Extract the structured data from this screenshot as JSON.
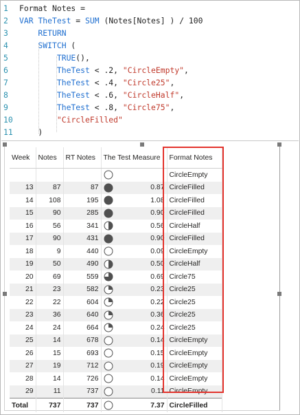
{
  "editor": {
    "lines": [
      {
        "n": "1",
        "tokens": [
          {
            "t": "Format Notes =",
            "c": "blk"
          }
        ]
      },
      {
        "n": "2",
        "tokens": [
          {
            "t": "VAR ",
            "c": "kw"
          },
          {
            "t": "TheTest",
            "c": "kw"
          },
          {
            "t": " = ",
            "c": "blk"
          },
          {
            "t": "SUM",
            "c": "kw"
          },
          {
            "t": " (Notes[Notes] ) / 100",
            "c": "blk"
          }
        ]
      },
      {
        "n": "3",
        "tokens": [
          {
            "t": "    RETURN",
            "c": "kw"
          }
        ]
      },
      {
        "n": "4",
        "tokens": [
          {
            "t": "    SWITCH",
            "c": "kw"
          },
          {
            "t": " (",
            "c": "blk"
          }
        ]
      },
      {
        "n": "5",
        "tokens": [
          {
            "t": "        TRUE",
            "c": "kw"
          },
          {
            "t": "(),",
            "c": "blk"
          }
        ]
      },
      {
        "n": "6",
        "tokens": [
          {
            "t": "        TheTest",
            "c": "kw"
          },
          {
            "t": " < .2, ",
            "c": "blk"
          },
          {
            "t": "\"CircleEmpty\"",
            "c": "str"
          },
          {
            "t": ",",
            "c": "blk"
          }
        ]
      },
      {
        "n": "7",
        "tokens": [
          {
            "t": "        TheTest",
            "c": "kw"
          },
          {
            "t": " < .4, ",
            "c": "blk"
          },
          {
            "t": "\"Circle25\"",
            "c": "str"
          },
          {
            "t": ",",
            "c": "blk"
          }
        ]
      },
      {
        "n": "8",
        "tokens": [
          {
            "t": "        TheTest",
            "c": "kw"
          },
          {
            "t": " < .6, ",
            "c": "blk"
          },
          {
            "t": "\"CircleHalf\"",
            "c": "str"
          },
          {
            "t": ",",
            "c": "blk"
          }
        ]
      },
      {
        "n": "9",
        "tokens": [
          {
            "t": "        TheTest",
            "c": "kw"
          },
          {
            "t": " < .8, ",
            "c": "blk"
          },
          {
            "t": "\"Circle75\"",
            "c": "str"
          },
          {
            "t": ",",
            "c": "blk"
          }
        ]
      },
      {
        "n": "10",
        "tokens": [
          {
            "t": "        ",
            "c": "blk"
          },
          {
            "t": "\"CircleFilled\"",
            "c": "str"
          }
        ]
      },
      {
        "n": "11",
        "tokens": [
          {
            "t": "    )",
            "c": "blk"
          }
        ]
      }
    ]
  },
  "table": {
    "headers": [
      "Week",
      "Notes",
      "RT Notes",
      "The Test Measure",
      "Format Notes"
    ],
    "rows": [
      {
        "week": "",
        "notes": "",
        "rt": "",
        "icon": "empty",
        "measure": "",
        "fmt": "CircleEmpty"
      },
      {
        "week": "13",
        "notes": "87",
        "rt": "87",
        "icon": "filled",
        "measure": "0.87",
        "fmt": "CircleFilled"
      },
      {
        "week": "14",
        "notes": "108",
        "rt": "195",
        "icon": "filled",
        "measure": "1.08",
        "fmt": "CircleFilled"
      },
      {
        "week": "15",
        "notes": "90",
        "rt": "285",
        "icon": "filled",
        "measure": "0.90",
        "fmt": "CircleFilled"
      },
      {
        "week": "16",
        "notes": "56",
        "rt": "341",
        "icon": "half",
        "measure": "0.56",
        "fmt": "CircleHalf"
      },
      {
        "week": "17",
        "notes": "90",
        "rt": "431",
        "icon": "filled",
        "measure": "0.90",
        "fmt": "CircleFilled"
      },
      {
        "week": "18",
        "notes": "9",
        "rt": "440",
        "icon": "empty",
        "measure": "0.09",
        "fmt": "CircleEmpty"
      },
      {
        "week": "19",
        "notes": "50",
        "rt": "490",
        "icon": "half",
        "measure": "0.50",
        "fmt": "CircleHalf"
      },
      {
        "week": "20",
        "notes": "69",
        "rt": "559",
        "icon": "c75",
        "measure": "0.69",
        "fmt": "Circle75"
      },
      {
        "week": "21",
        "notes": "23",
        "rt": "582",
        "icon": "c25",
        "measure": "0.23",
        "fmt": "Circle25"
      },
      {
        "week": "22",
        "notes": "22",
        "rt": "604",
        "icon": "c25",
        "measure": "0.22",
        "fmt": "Circle25"
      },
      {
        "week": "23",
        "notes": "36",
        "rt": "640",
        "icon": "c25",
        "measure": "0.36",
        "fmt": "Circle25"
      },
      {
        "week": "24",
        "notes": "24",
        "rt": "664",
        "icon": "c25",
        "measure": "0.24",
        "fmt": "Circle25"
      },
      {
        "week": "25",
        "notes": "14",
        "rt": "678",
        "icon": "empty",
        "measure": "0.14",
        "fmt": "CircleEmpty"
      },
      {
        "week": "26",
        "notes": "15",
        "rt": "693",
        "icon": "empty",
        "measure": "0.15",
        "fmt": "CircleEmpty"
      },
      {
        "week": "27",
        "notes": "19",
        "rt": "712",
        "icon": "empty",
        "measure": "0.19",
        "fmt": "CircleEmpty"
      },
      {
        "week": "28",
        "notes": "14",
        "rt": "726",
        "icon": "empty",
        "measure": "0.14",
        "fmt": "CircleEmpty"
      },
      {
        "week": "29",
        "notes": "11",
        "rt": "737",
        "icon": "empty",
        "measure": "0.11",
        "fmt": "CircleEmpty"
      }
    ],
    "total": {
      "label": "Total",
      "notes": "737",
      "rt": "737",
      "icon": "empty",
      "measure": "7.37",
      "fmt": "CircleFilled"
    }
  },
  "colors": {
    "keyword": "#1f6fd0",
    "string": "#c0392b",
    "line_number": "#2b91af",
    "highlight_box": "#e3322b",
    "circle_fill": "#505050",
    "row_alt": "#efefef"
  }
}
